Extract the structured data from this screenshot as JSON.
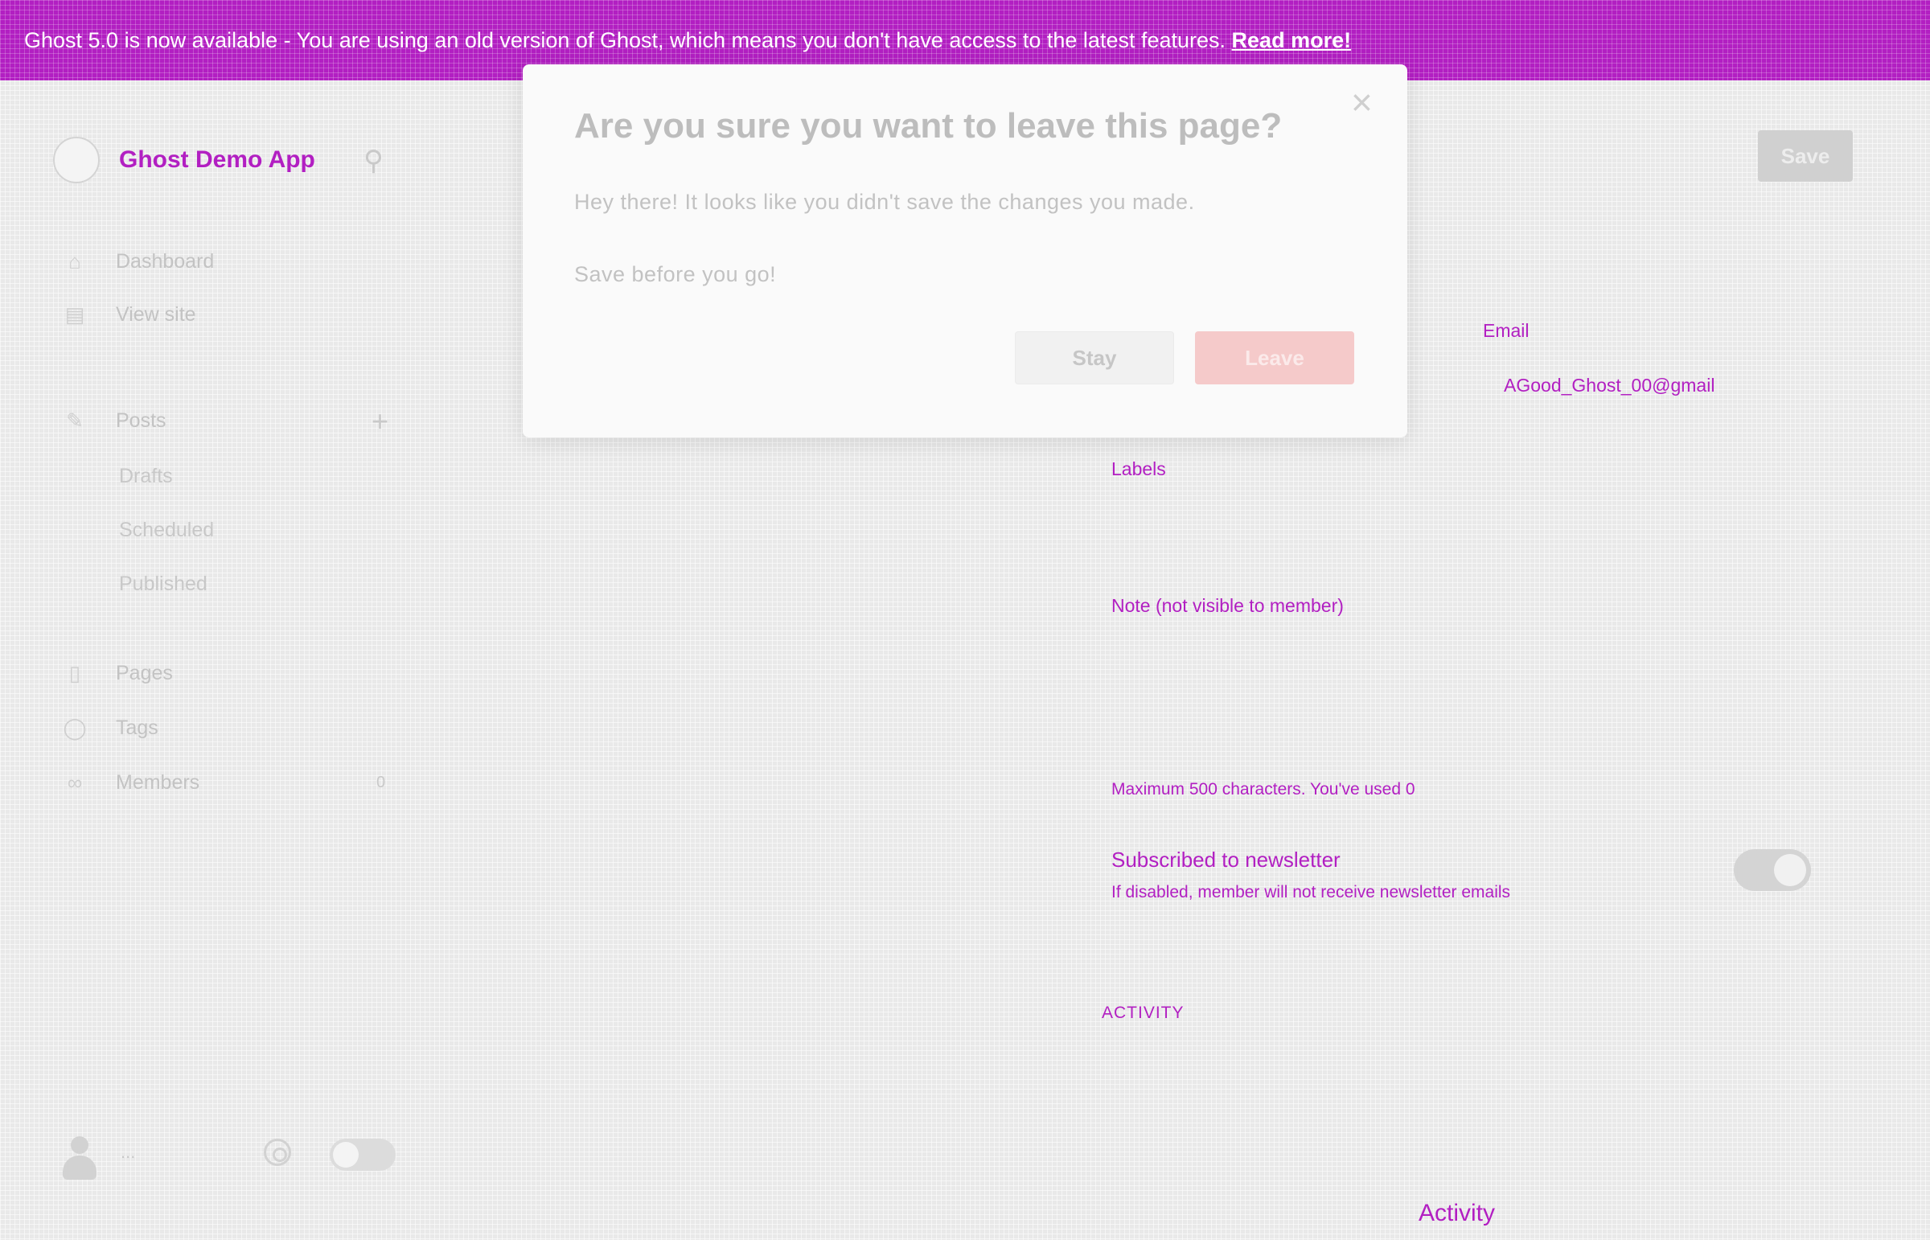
{
  "banner": {
    "text": "Ghost 5.0 is now available - You are using an old version of Ghost, which means you don't have access to the latest features.",
    "link_label": "Read more!"
  },
  "sidebar": {
    "site_title": "Ghost Demo App",
    "items": [
      {
        "label": "Dashboard",
        "icon": "home-icon"
      },
      {
        "label": "View site",
        "icon": "browser-icon"
      },
      {
        "label": "Posts",
        "icon": "pencil-icon"
      },
      {
        "label": "Drafts"
      },
      {
        "label": "Scheduled"
      },
      {
        "label": "Published"
      },
      {
        "label": "Pages",
        "icon": "page-icon"
      },
      {
        "label": "Tags",
        "icon": "tag-icon"
      },
      {
        "label": "Members",
        "icon": "members-icon"
      }
    ],
    "members_count": "0",
    "user_menu": "..."
  },
  "header": {
    "save_label": "Save"
  },
  "member_form": {
    "email_label": "Email",
    "email_value": "AGood_Ghost_00@gmail",
    "labels_label": "Labels",
    "note_label": "Note (not visible to member)",
    "note_hint": "Maximum 500 characters. You've used 0",
    "subscription_title": "Subscribed to newsletter",
    "subscription_hint": "If disabled, member will not receive newsletter emails",
    "subscribed": true,
    "activity_section": "ACTIVITY",
    "activity_title": "Activity"
  },
  "modal": {
    "title": "Are you sure you want to leave this page?",
    "text1": "Hey there! It looks like you didn't save the changes you made.",
    "text2": "Save before you go!",
    "stay_label": "Stay",
    "leave_label": "Leave",
    "close_icon": "close-icon"
  },
  "colors": {
    "banner": "#b21fc2",
    "leave_button": "#f5caca",
    "accent_text": "#b21fc2"
  }
}
